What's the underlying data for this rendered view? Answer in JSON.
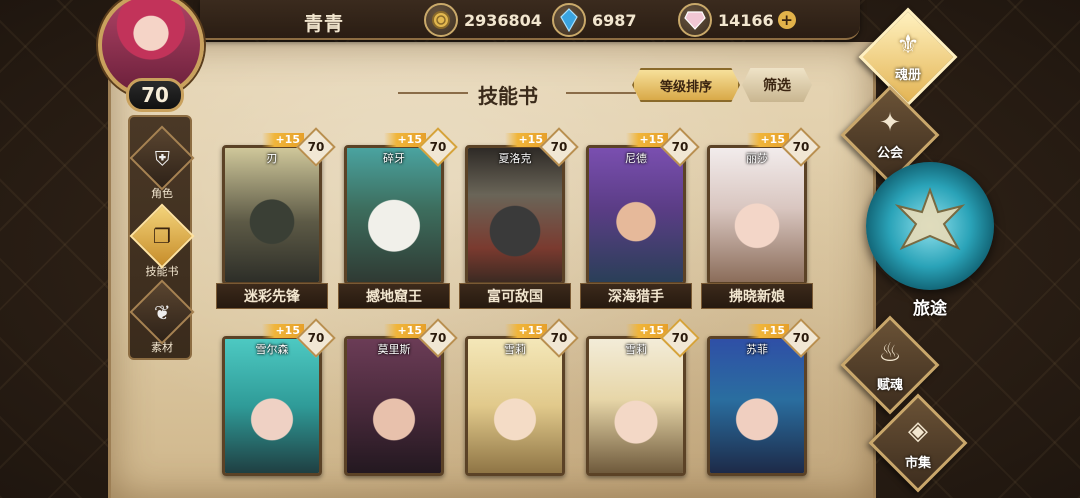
{
  "header": {
    "player_name": "青青",
    "level": "70",
    "gold": "2936804",
    "crystal": "6987",
    "gem": "14166",
    "plus_label": "+"
  },
  "left_nav": [
    {
      "label": "角色",
      "icon": "helmet-icon",
      "active": false
    },
    {
      "label": "技能书",
      "icon": "book-icon",
      "active": true
    },
    {
      "label": "素材",
      "icon": "wing-icon",
      "active": false
    }
  ],
  "page": {
    "title": "技能书",
    "sort_label": "等级排序",
    "filter_label": "筛选"
  },
  "cards": [
    {
      "name": "刃",
      "title": "迷彩先锋",
      "bonus": "+15",
      "level": "70"
    },
    {
      "name": "碎牙",
      "title": "撼地窟王",
      "bonus": "+15",
      "level": "70"
    },
    {
      "name": "夏洛克",
      "title": "富可敌国",
      "bonus": "+15",
      "level": "70"
    },
    {
      "name": "尼德",
      "title": "深海猎手",
      "bonus": "+15",
      "level": "70"
    },
    {
      "name": "丽莎",
      "title": "拂晓新娘",
      "bonus": "+15",
      "level": "70"
    },
    {
      "name": "雪尔森",
      "title": "",
      "bonus": "+15",
      "level": "70"
    },
    {
      "name": "莫里斯",
      "title": "",
      "bonus": "+15",
      "level": "70"
    },
    {
      "name": "雪莉",
      "title": "",
      "bonus": "+15",
      "level": "70"
    },
    {
      "name": "雪莉",
      "title": "",
      "bonus": "+15",
      "level": "70"
    },
    {
      "name": "苏菲",
      "title": "",
      "bonus": "+15",
      "level": "70"
    }
  ],
  "right_nav": {
    "soul_book": "魂册",
    "guild": "公会",
    "journey": "旅途",
    "talent_soul": "赋魂",
    "market": "市集"
  },
  "colors": {
    "parchment": "#dcc8a1",
    "accent_gold": "#e6a02a",
    "frame_dark": "#2a1d13"
  }
}
